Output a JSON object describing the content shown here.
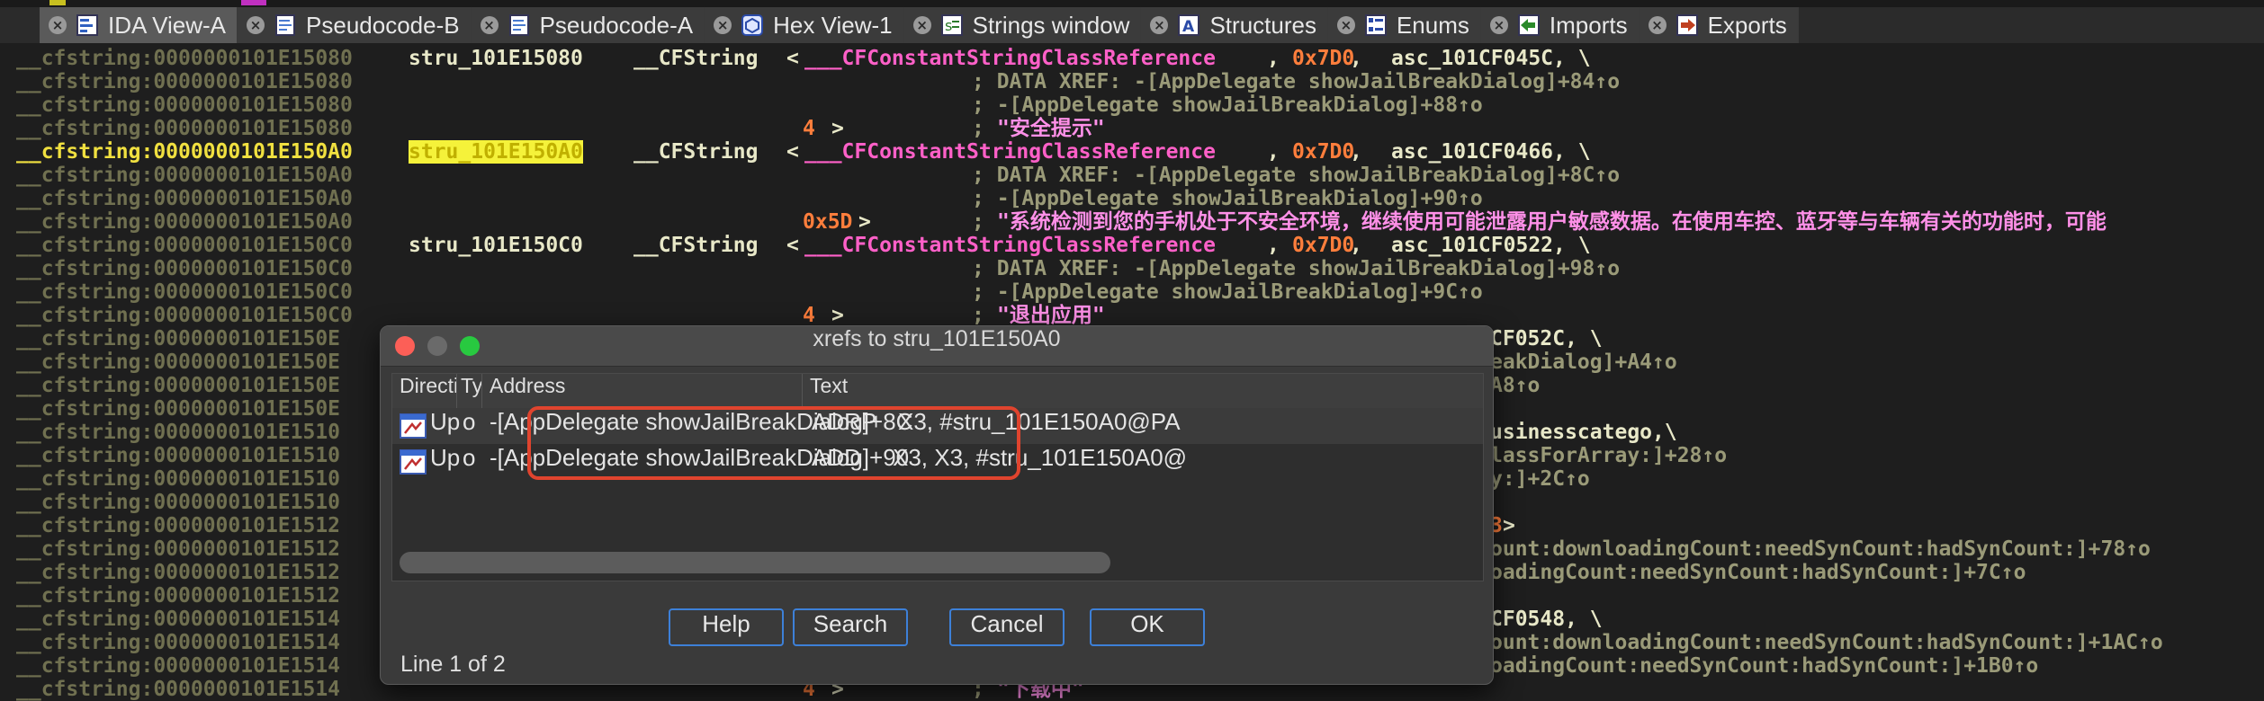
{
  "tabs": [
    {
      "label": "IDA View-A",
      "icon": "ida-view-icon",
      "active": true
    },
    {
      "label": "Pseudocode-B",
      "icon": "pseudocode-icon"
    },
    {
      "label": "Pseudocode-A",
      "icon": "pseudocode-icon"
    },
    {
      "label": "Hex View-1",
      "icon": "hex-view-icon"
    },
    {
      "label": "Strings window",
      "icon": "strings-icon"
    },
    {
      "label": "Structures",
      "icon": "structures-icon"
    },
    {
      "label": "Enums",
      "icon": "enums-icon"
    },
    {
      "label": "Imports",
      "icon": "imports-icon"
    },
    {
      "label": "Exports",
      "icon": "exports-icon"
    }
  ],
  "tab_close_glyph": "×",
  "disasm": {
    "addr_ghost": "__cfstring:0000000101E1514",
    "lines": [
      {
        "addr": "__cfstring:0000000101E15080",
        "label": "stru_101E15080",
        "type": "__CFString",
        "lt": "<",
        "kw": "___CFConstantStringClassReference",
        "sep1": ",",
        "num": "0x7D0",
        "sep2": ",",
        "id": "asc_101CF045C, \\"
      },
      {
        "addr": "__cfstring:0000000101E15080",
        "cmt": "; DATA XREF: -[AppDelegate showJailBreakDialog]+84↑o"
      },
      {
        "addr": "__cfstring:0000000101E15080",
        "cmt": "; -[AppDelegate showJailBreakDialog]+88↑o"
      },
      {
        "addr": "__cfstring:0000000101E15080",
        "num2": "4",
        "gt": ">",
        "cmt": "; ",
        "str": "\"安全提示\""
      },
      {
        "addr": "__cfstring:0000000101E150A0",
        "cur": true,
        "labelhl": "stru_101E150A0",
        "type": "__CFString",
        "lt": "<",
        "kw": "___CFConstantStringClassReference",
        "sep1": ",",
        "num": "0x7D0",
        "sep2": ",",
        "id": "asc_101CF0466, \\"
      },
      {
        "addr": "__cfstring:0000000101E150A0",
        "cmt": "; DATA XREF: -[AppDelegate showJailBreakDialog]+8C↑o"
      },
      {
        "addr": "__cfstring:0000000101E150A0",
        "cmt": "; -[AppDelegate showJailBreakDialog]+90↑o"
      },
      {
        "addr": "__cfstring:0000000101E150A0",
        "num2": "0x5D",
        "gt": ">",
        "cmt": "; ",
        "str": "\"系统检测到您的手机处于不安全环境，继续使用可能泄露用户敏感数据。在使用车控、蓝牙等与车辆有关的功能时，可能"
      },
      {
        "addr": "__cfstring:0000000101E150C0",
        "label": "stru_101E150C0",
        "type": "__CFString",
        "lt": "<",
        "kw": "___CFConstantStringClassReference",
        "sep1": ",",
        "num": "0x7D0",
        "sep2": ",",
        "id": "asc_101CF0522, \\"
      },
      {
        "addr": "__cfstring:0000000101E150C0",
        "cmt": "; DATA XREF: -[AppDelegate showJailBreakDialog]+98↑o"
      },
      {
        "addr": "__cfstring:0000000101E150C0",
        "cmt": "; -[AppDelegate showJailBreakDialog]+9C↑o"
      },
      {
        "addr": "__cfstring:0000000101E150C0",
        "num2": "4",
        "gt": ">",
        "cmt": "; ",
        "str": "\"退出应用\""
      },
      {
        "addr": "__cfstring:0000000101E150E",
        "tail_id": "CF052C, \\"
      },
      {
        "addr": "__cfstring:0000000101E150E",
        "tail_cmt": "eakDialog]+A4↑o"
      },
      {
        "addr": "__cfstring:0000000101E150E",
        "tail_cmt": "A8↑o"
      },
      {
        "addr": "__cfstring:0000000101E150E"
      },
      {
        "addr": "__cfstring:0000000101E1510",
        "tail_id": "usinesscatego,\\"
      },
      {
        "addr": "__cfstring:0000000101E1510",
        "tail_cmt": "lassForArray:]+28↑o"
      },
      {
        "addr": "__cfstring:0000000101E1510",
        "tail_cmt": "y:]+2C↑o"
      },
      {
        "addr": "__cfstring:0000000101E1510"
      },
      {
        "addr": "__cfstring:0000000101E1512",
        "tail_num": "3",
        "tail_gt": ">"
      },
      {
        "addr": "__cfstring:0000000101E1512",
        "tail_cmt": "ount:downloadingCount:needSynCount:hadSynCount:]+78↑o"
      },
      {
        "addr": "__cfstring:0000000101E1512",
        "tail_cmt": "oadingCount:needSynCount:hadSynCount:]+7C↑o"
      },
      {
        "addr": "__cfstring:0000000101E1512"
      },
      {
        "addr": "__cfstring:0000000101E1514",
        "tail_id": "CF0548, \\"
      },
      {
        "addr": "__cfstring:0000000101E1514",
        "tail_cmt": "ount:downloadingCount:needSynCount:hadSynCount:]+1AC↑o"
      },
      {
        "addr": "__cfstring:0000000101E1514",
        "tail_cmt": "oadingCount:needSynCount:hadSynCount:]+1B0↑o"
      },
      {
        "addr": "__cfstring:0000000101E1514",
        "num2": "4",
        "gt": ">",
        "cmt": "; ",
        "str": "\"下载中\""
      }
    ]
  },
  "dialog": {
    "title": "xrefs to stru_101E150A0",
    "columns": [
      "Direction",
      "Typ",
      "Address",
      "Text"
    ],
    "rows": [
      {
        "icon": "xref-row-icon",
        "direction": "Up",
        "type": "o",
        "address": "-[AppDelegate showJailBreakDialog]+8C",
        "text_op": "ADRP",
        "text_args": "X3, #stru_101E150A0@PA"
      },
      {
        "icon": "xref-row-icon",
        "direction": "Up",
        "type": "o",
        "address": "-[AppDelegate showJailBreakDialog]+90",
        "text_op": "ADD",
        "text_args": "X3, X3, #stru_101E150A0@"
      }
    ],
    "buttons": {
      "help": "Help",
      "search": "Search",
      "cancel": "Cancel",
      "ok": "OK"
    },
    "status": "Line 1 of 2"
  },
  "colors": {
    "highlight_box": "#e0442e",
    "selected_label_bg": "#f5f23a",
    "button_border": "#3d80d8"
  }
}
